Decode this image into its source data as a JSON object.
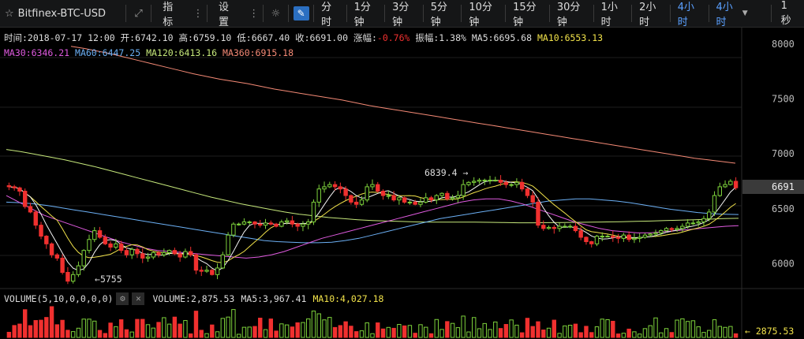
{
  "toolbar": {
    "symbol": "Bitfinex-BTC-USD",
    "indicators_label": "指标",
    "settings_label": "设置",
    "intervals": [
      "分时",
      "1分钟",
      "3分钟",
      "5分钟",
      "10分钟",
      "15分钟",
      "30分钟",
      "1小时",
      "2小时",
      "4小时"
    ],
    "active_interval": "4小时",
    "interval_dropdown_label": "4小时",
    "refresh_label": "1秒"
  },
  "info": {
    "time": "时间:2018-07-17 12:00",
    "open": "开:6742.10",
    "high": "高:6759.10",
    "low": "低:6667.40",
    "close": "收:6691.00",
    "change_label": "涨幅:",
    "change_value": "-0.76%",
    "amplitude": "振幅:1.38%",
    "ma5": "MA5:6695.68",
    "ma10": "MA10:6553.13",
    "ma30": "MA30:6346.21",
    "ma60": "MA60:6447.25",
    "ma120": "MA120:6413.16",
    "ma360": "MA360:6915.18"
  },
  "volume_info": {
    "label": "VOLUME(5,10,0,0,0,0)",
    "volume": "VOLUME:2,875.53",
    "ma5": "MA5:3,967.41",
    "ma10": "MA10:4,027.18",
    "last_marker": "2875.53"
  },
  "chart_data": {
    "type": "candlestick",
    "y_ticks": [
      6000,
      6500,
      7000,
      7500,
      8000
    ],
    "ylim": [
      5780,
      8100
    ],
    "current_price_label": "6691",
    "max_annotation": "6839.4",
    "min_annotation": "5755",
    "colors": {
      "up": "#7dd13b",
      "down": "#f0302f",
      "ma5": "#f5f5f5",
      "ma10": "#f1e24a",
      "ma30": "#e05be0",
      "ma60": "#6cb0f5",
      "ma120": "#c6e87b",
      "ma360": "#f58a76"
    },
    "closes": [
      6700,
      6690,
      6660,
      6520,
      6470,
      6350,
      6250,
      6180,
      6080,
      6050,
      5920,
      5840,
      5900,
      5980,
      6120,
      6220,
      6300,
      6240,
      6180,
      6150,
      6180,
      6120,
      6080,
      6130,
      6090,
      6050,
      6060,
      6100,
      6080,
      6100,
      6120,
      6090,
      6060,
      6110,
      6080,
      5940,
      5930,
      5940,
      5900,
      5960,
      6080,
      6260,
      6360,
      6360,
      6380,
      6380,
      6360,
      6350,
      6370,
      6360,
      6340,
      6380,
      6390,
      6360,
      6340,
      6360,
      6380,
      6560,
      6680,
      6700,
      6720,
      6700,
      6680,
      6620,
      6560,
      6540,
      6580,
      6700,
      6720,
      6660,
      6620,
      6620,
      6580,
      6600,
      6560,
      6560,
      6540,
      6560,
      6600,
      6580,
      6620,
      6640,
      6590,
      6600,
      6620,
      6720,
      6740,
      6750,
      6760,
      6760,
      6760,
      6760,
      6740,
      6720,
      6720,
      6740,
      6680,
      6620,
      6560,
      6350,
      6320,
      6330,
      6320,
      6340,
      6340,
      6340,
      6300,
      6240,
      6200,
      6180,
      6250,
      6250,
      6250,
      6240,
      6230,
      6260,
      6220,
      6230,
      6240,
      6260,
      6270,
      6280,
      6300,
      6320,
      6310,
      6320,
      6340,
      6370,
      6370,
      6380,
      6410,
      6470,
      6620,
      6700,
      6720,
      6750,
      6691
    ],
    "ma360": [
      7980,
      7960,
      7935,
      7910,
      7880,
      7850,
      7820,
      7790,
      7760,
      7730,
      7705,
      7680,
      7660,
      7640,
      7615,
      7590,
      7570,
      7550,
      7530,
      7510,
      7490,
      7465,
      7440,
      7420,
      7400,
      7380,
      7360,
      7340,
      7320,
      7300,
      7280,
      7260,
      7240,
      7220,
      7200,
      7180,
      7160,
      7140,
      7120,
      7100,
      7080,
      7060,
      7040,
      7020,
      7000,
      6980,
      6960,
      6945,
      6930,
      6915
    ],
    "ma120": [
      7040,
      7020,
      6995,
      6970,
      6945,
      6915,
      6885,
      6850,
      6815,
      6780,
      6745,
      6710,
      6675,
      6640,
      6605,
      6575,
      6545,
      6520,
      6495,
      6470,
      6450,
      6435,
      6420,
      6410,
      6400,
      6393,
      6388,
      6384,
      6380,
      6378,
      6378,
      6378,
      6378,
      6376,
      6374,
      6372,
      6372,
      6373,
      6374,
      6376,
      6378,
      6380,
      6382,
      6385,
      6388,
      6392,
      6396,
      6400,
      6405,
      6410,
      6413
    ],
    "ma60": [
      6560,
      6555,
      6545,
      6530,
      6510,
      6490,
      6470,
      6450,
      6430,
      6410,
      6390,
      6370,
      6350,
      6330,
      6310,
      6290,
      6270,
      6250,
      6230,
      6210,
      6200,
      6195,
      6190,
      6190,
      6195,
      6210,
      6230,
      6260,
      6290,
      6320,
      6350,
      6380,
      6410,
      6430,
      6450,
      6470,
      6490,
      6510,
      6530,
      6550,
      6570,
      6580,
      6590,
      6590,
      6580,
      6570,
      6555,
      6535,
      6515,
      6495,
      6480,
      6465,
      6455,
      6450,
      6447
    ],
    "ma30": [
      6620,
      6560,
      6500,
      6440,
      6400,
      6360,
      6320,
      6280,
      6240,
      6200,
      6170,
      6140,
      6120,
      6110,
      6100,
      6090,
      6080,
      6070,
      6060,
      6050,
      6060,
      6080,
      6110,
      6150,
      6190,
      6230,
      6260,
      6290,
      6320,
      6350,
      6380,
      6410,
      6440,
      6470,
      6500,
      6530,
      6560,
      6580,
      6590,
      6590,
      6570,
      6540,
      6500,
      6460,
      6420,
      6380,
      6350,
      6320,
      6300,
      6290,
      6280,
      6280,
      6290,
      6300,
      6310,
      6320,
      6330,
      6340,
      6346
    ]
  }
}
